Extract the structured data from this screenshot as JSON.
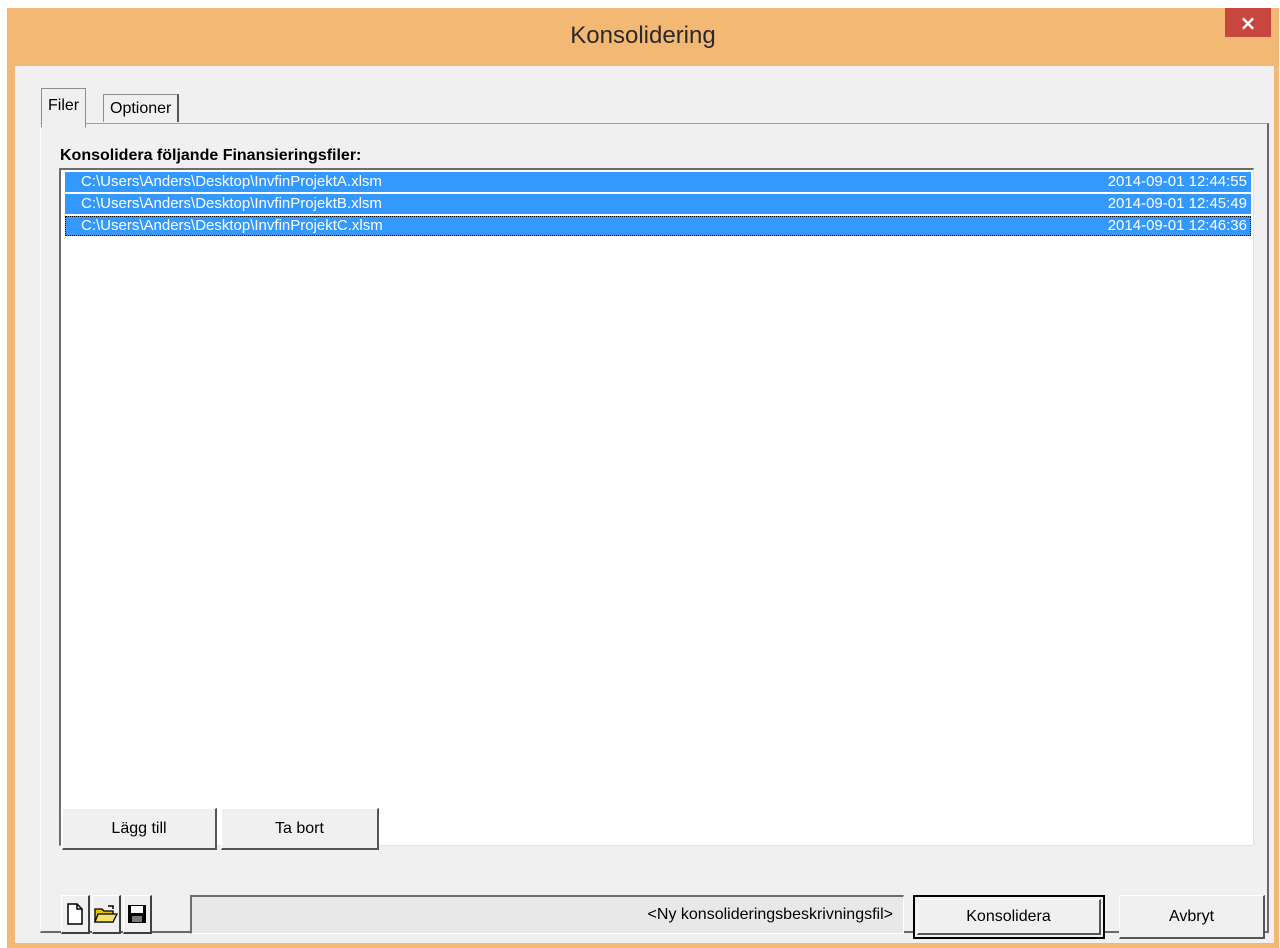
{
  "window": {
    "title": "Konsolidering",
    "close_label": "×"
  },
  "tabs": [
    {
      "label": "Filer",
      "active": true
    },
    {
      "label": "Optioner",
      "active": false
    }
  ],
  "files_section": {
    "label": "Konsolidera följande Finansieringsfiler:",
    "files": [
      {
        "path": "C:\\Users\\Anders\\Desktop\\InvfinProjektA.xlsm",
        "date": "2014-09-01 12:44:55",
        "selected": true
      },
      {
        "path": "C:\\Users\\Anders\\Desktop\\InvfinProjektB.xlsm",
        "date": "2014-09-01 12:45:49",
        "selected": true
      },
      {
        "path": "C:\\Users\\Anders\\Desktop\\InvfinProjektC.xlsm",
        "date": "2014-09-01 12:46:36",
        "selected": true
      }
    ],
    "add_label": "Lägg till",
    "remove_label": "Ta bort"
  },
  "footer": {
    "icons": [
      "new-file-icon",
      "open-folder-icon",
      "save-disk-icon"
    ],
    "description_file": "<Ny konsolideringsbeskrivningsfil>",
    "consolidate_label": "Konsolidera",
    "cancel_label": "Avbryt"
  },
  "colors": {
    "titlebar": "#f3b873",
    "selection": "#3399ff",
    "close": "#c7463d"
  }
}
